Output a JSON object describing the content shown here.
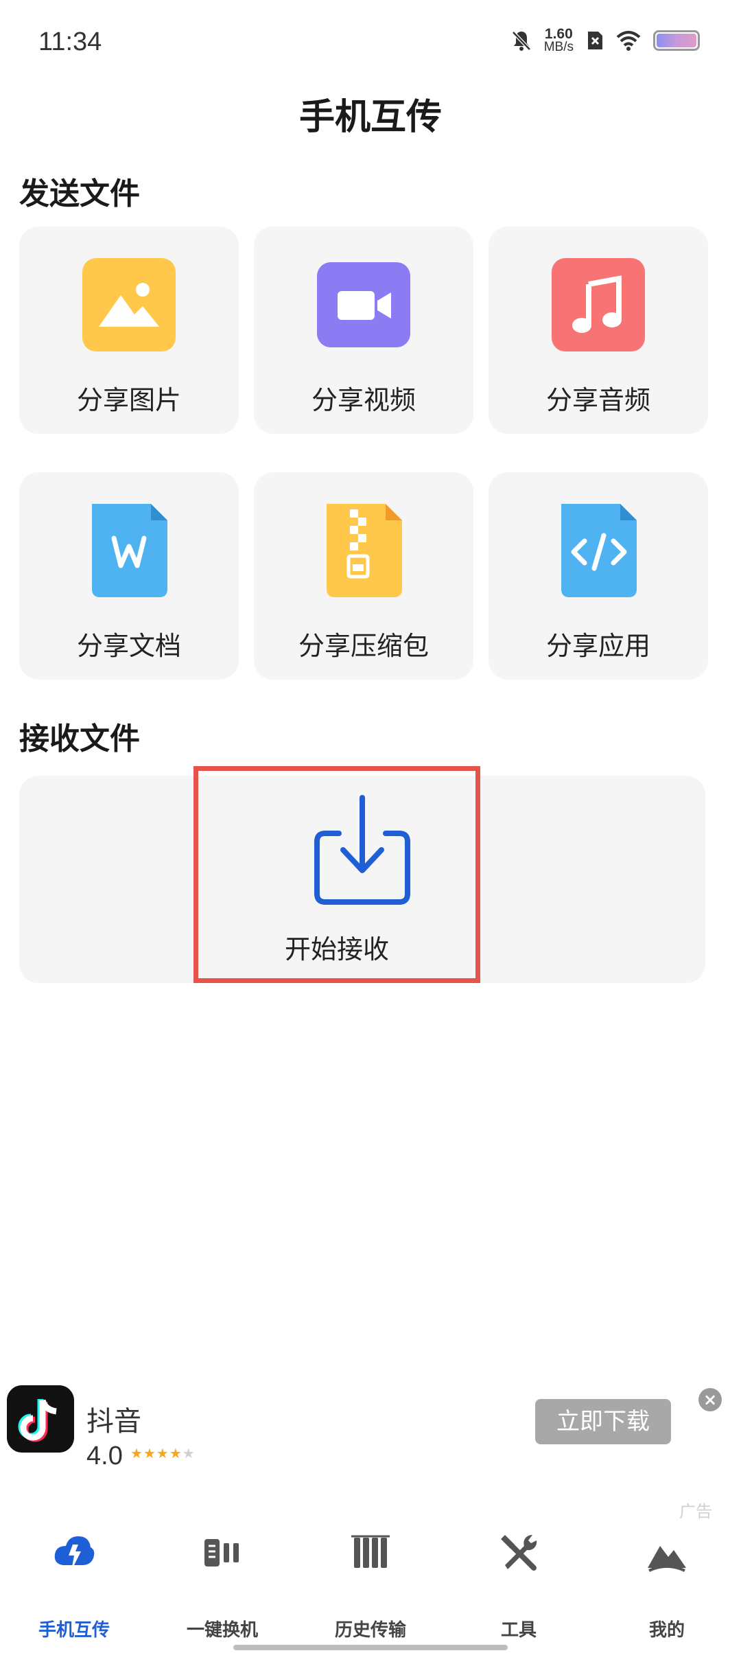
{
  "status_bar": {
    "time": "11:34",
    "net_speed_value": "1.60",
    "net_speed_unit": "MB/s"
  },
  "page_title": "手机互传",
  "send_section": {
    "title": "发送文件",
    "items": [
      {
        "label": "分享图片",
        "icon": "image-icon",
        "color": "#ffc84a"
      },
      {
        "label": "分享视频",
        "icon": "video-icon",
        "color": "#8b7cf3"
      },
      {
        "label": "分享音频",
        "icon": "music-icon",
        "color": "#f87474"
      },
      {
        "label": "分享文档",
        "icon": "document-icon",
        "color": "#4fb3f2"
      },
      {
        "label": "分享压缩包",
        "icon": "zip-icon",
        "color": "#ffc84a"
      },
      {
        "label": "分享应用",
        "icon": "code-icon",
        "color": "#4fb3f2"
      }
    ]
  },
  "receive_section": {
    "title": "接收文件",
    "button_label": "开始接收",
    "icon": "download-tray-icon",
    "highlight_color": "#e5534b"
  },
  "ad": {
    "app_name": "抖音",
    "rating": "4.0",
    "stars_filled": 4,
    "stars_total": 5,
    "download_label": "立即下载",
    "tag": "广告"
  },
  "bottom_nav": {
    "items": [
      {
        "label": "手机互传",
        "icon": "transfer-icon",
        "active": true
      },
      {
        "label": "一键换机",
        "icon": "switch-phone-icon",
        "active": false
      },
      {
        "label": "历史传输",
        "icon": "history-icon",
        "active": false
      },
      {
        "label": "工具",
        "icon": "tools-icon",
        "active": false
      },
      {
        "label": "我的",
        "icon": "profile-icon",
        "active": false
      }
    ],
    "active_color": "#1f5fd6"
  }
}
